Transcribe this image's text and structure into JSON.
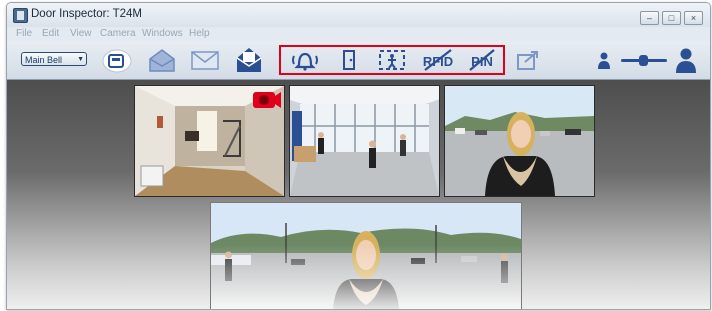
{
  "window": {
    "title": "Door Inspector: T24M"
  },
  "menu": [
    "File",
    "Edit",
    "View",
    "Camera",
    "Windows",
    "Help"
  ],
  "toolbar": {
    "camera_select": "Main Bell",
    "highlighted_icons": [
      "bell-icon",
      "door-icon",
      "motion-detection-icon",
      "rfid-disabled-icon",
      "pin-disabled-icon"
    ],
    "accent_color": "#2b4f93",
    "highlight_color": "#e0001a"
  },
  "labels": {
    "rfid": "RFID",
    "pin": "PIN"
  },
  "views": [
    {
      "name": "camera-view-lobby",
      "description_icon": "lobby"
    },
    {
      "name": "camera-view-hall",
      "description_icon": "hall"
    },
    {
      "name": "camera-view-entrance",
      "description_icon": "entrance"
    },
    {
      "name": "camera-view-panorama",
      "description_icon": "panorama"
    }
  ]
}
